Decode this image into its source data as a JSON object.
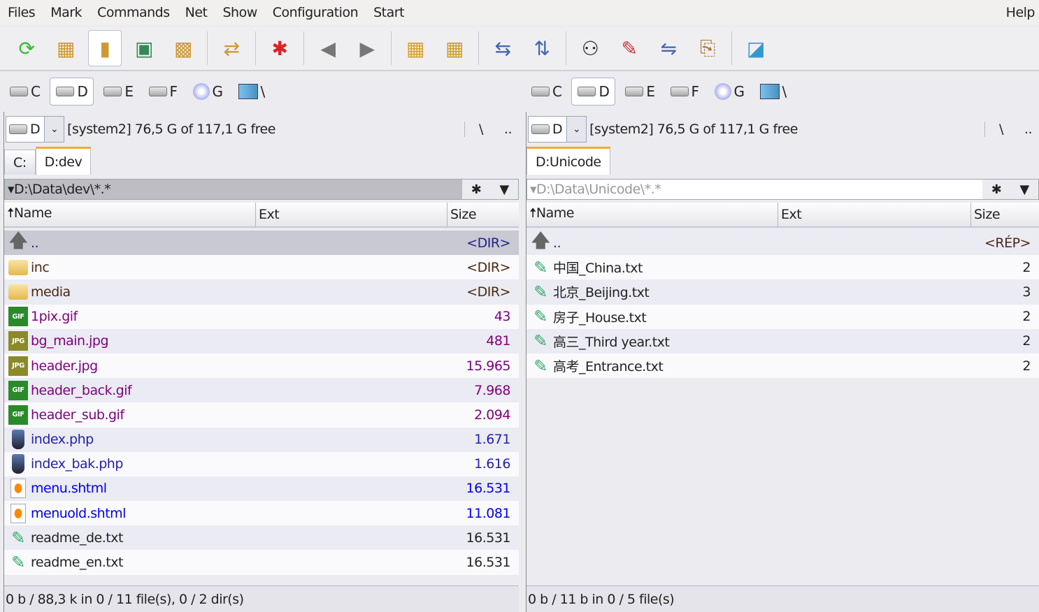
{
  "menu": [
    "Files",
    "Mark",
    "Commands",
    "Net",
    "Show",
    "Configuration",
    "Start"
  ],
  "help": "Help",
  "toolbar": [
    {
      "icon": "refresh-icon",
      "glyph": "⟳",
      "color": "#3b3"
    },
    {
      "icon": "brief-view-icon",
      "glyph": "▦",
      "color": "#c93"
    },
    {
      "icon": "full-view-icon",
      "glyph": "▮",
      "color": "#c93",
      "active": true
    },
    {
      "icon": "thumbnail-view-icon",
      "glyph": "▣",
      "color": "#385"
    },
    {
      "icon": "tree-view-icon",
      "glyph": "▩",
      "color": "#c93"
    },
    {
      "sep": true
    },
    {
      "icon": "sync-dirs-icon",
      "glyph": "⇄",
      "color": "#c93"
    },
    {
      "sep": true
    },
    {
      "icon": "mark-files-icon",
      "glyph": "✱",
      "color": "#d22"
    },
    {
      "sep": true
    },
    {
      "icon": "back-arrow-icon",
      "glyph": "◀",
      "color": "#777"
    },
    {
      "icon": "forward-arrow-icon",
      "glyph": "▶",
      "color": "#777"
    },
    {
      "sep": true
    },
    {
      "icon": "pack-icon",
      "glyph": "▦",
      "color": "#d9a030"
    },
    {
      "icon": "unpack-icon",
      "glyph": "▦",
      "color": "#c9a030"
    },
    {
      "sep": true
    },
    {
      "icon": "ftp-connect-icon",
      "glyph": "⇆",
      "color": "#46a"
    },
    {
      "icon": "url-connect-icon",
      "glyph": "⇅",
      "color": "#46a"
    },
    {
      "sep": true
    },
    {
      "icon": "search-binoculars-icon",
      "glyph": "⚇",
      "color": "#222"
    },
    {
      "icon": "multi-rename-icon",
      "glyph": "✎",
      "color": "#c33"
    },
    {
      "icon": "compare-dirs-icon",
      "glyph": "⇋",
      "color": "#46a"
    },
    {
      "icon": "copy-clipboard-icon",
      "glyph": "⎘",
      "color": "#a73"
    },
    {
      "sep": true
    },
    {
      "icon": "notepad-icon",
      "glyph": "◪",
      "color": "#39c"
    }
  ],
  "drives": [
    {
      "letter": "C",
      "type": "hdd"
    },
    {
      "letter": "D",
      "type": "hdd",
      "active": true
    },
    {
      "letter": "E",
      "type": "hdd"
    },
    {
      "letter": "F",
      "type": "hdd"
    },
    {
      "letter": "G",
      "type": "cd"
    },
    {
      "letter": "\\",
      "type": "net"
    }
  ],
  "left": {
    "drive": "D",
    "info": "[system2]  76,5 G of 117,1 G free",
    "root": "\\",
    "parent": "..",
    "tabs": [
      {
        "label": "C:"
      },
      {
        "label": "D:dev",
        "active": true
      }
    ],
    "path": "▾D:\\Data\\dev\\*.*",
    "star": "✱",
    "down": "▼",
    "cols": {
      "name": "🠅Name",
      "ext": "Ext",
      "size": "Size"
    },
    "rows": [
      {
        "name": "..",
        "size": "<DIR>",
        "icon": "up",
        "color": "#22228a",
        "sel": true
      },
      {
        "name": "inc",
        "size": "<DIR>",
        "icon": "folder",
        "color": "#4a2a10"
      },
      {
        "name": "media",
        "size": "<DIR>",
        "icon": "folder",
        "color": "#4a2a10"
      },
      {
        "name": "1pix.gif",
        "size": "43",
        "icon": "gif",
        "color": "#800080"
      },
      {
        "name": "bg_main.jpg",
        "size": "481",
        "icon": "jpg",
        "color": "#800080"
      },
      {
        "name": "header.jpg",
        "size": "15.965",
        "icon": "jpg",
        "color": "#800080"
      },
      {
        "name": "header_back.gif",
        "size": "7.968",
        "icon": "gif",
        "color": "#800080"
      },
      {
        "name": "header_sub.gif",
        "size": "2.094",
        "icon": "gif",
        "color": "#800080"
      },
      {
        "name": "index.php",
        "size": "1.671",
        "icon": "php",
        "color": "#2222aa"
      },
      {
        "name": "index_bak.php",
        "size": "1.616",
        "icon": "php",
        "color": "#2222aa"
      },
      {
        "name": "menu.shtml",
        "size": "16.531",
        "icon": "html",
        "color": "#0000ee"
      },
      {
        "name": "menuold.shtml",
        "size": "11.081",
        "icon": "html",
        "color": "#0000ee"
      },
      {
        "name": "readme_de.txt",
        "size": "16.531",
        "icon": "txt",
        "color": "#222222"
      },
      {
        "name": "readme_en.txt",
        "size": "16.531",
        "icon": "txt",
        "color": "#222222"
      }
    ],
    "status": "0 b / 88,3 k in 0 / 11 file(s), 0 / 2 dir(s)"
  },
  "right": {
    "drive": "D",
    "info": "[system2]  76,5 G of 117,1 G free",
    "root": "\\",
    "parent": "..",
    "tabs": [
      {
        "label": "D:Unicode",
        "active": true
      }
    ],
    "path": "▾D:\\Data\\Unicode\\*.*",
    "star": "✱",
    "down": "▼",
    "cols": {
      "name": "🠅Name",
      "ext": "Ext",
      "size": "Size"
    },
    "rows": [
      {
        "name": "..",
        "size": "<RÉP>",
        "icon": "up",
        "color": "#4a2a10"
      },
      {
        "name": "中国_China.txt",
        "size": "2",
        "icon": "txt",
        "color": "#222222"
      },
      {
        "name": "北京_Beijing.txt",
        "size": "3",
        "icon": "txt",
        "color": "#222222"
      },
      {
        "name": "房子_House.txt",
        "size": "2",
        "icon": "txt",
        "color": "#222222"
      },
      {
        "name": "高三_Third year.txt",
        "size": "2",
        "icon": "txt",
        "color": "#222222"
      },
      {
        "name": "高考_Entrance.txt",
        "size": "2",
        "icon": "txt",
        "color": "#222222"
      }
    ],
    "status": "0 b / 11 b in 0 / 5 file(s)"
  }
}
